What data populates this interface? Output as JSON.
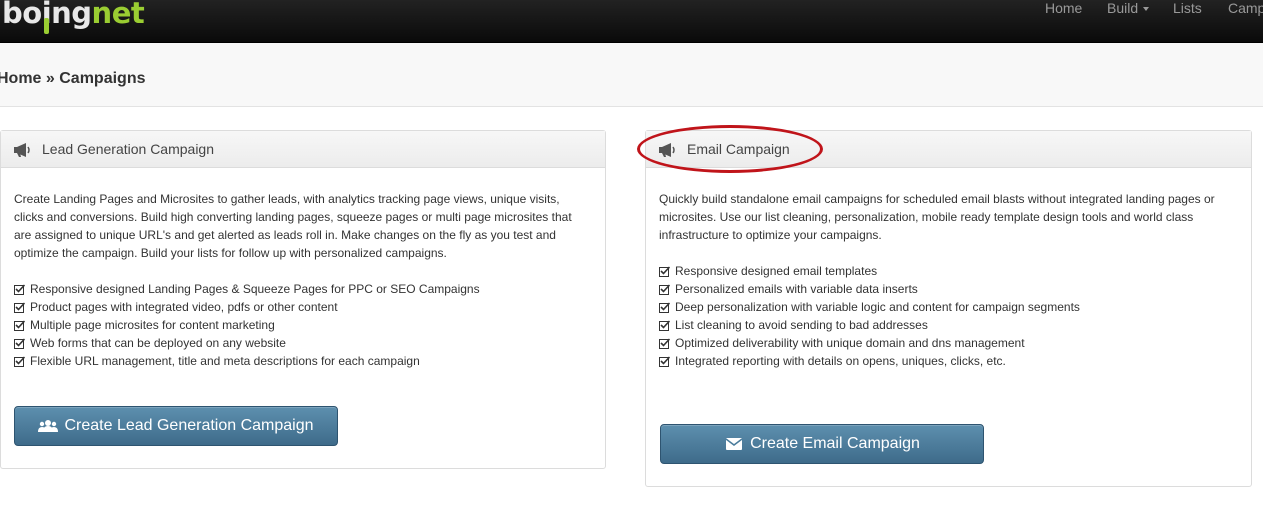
{
  "header": {
    "logo_prefix": "bo",
    "logo_mid": "i",
    "logo_suffix": "ng",
    "logo_net": "net",
    "nav": [
      {
        "label": "Home"
      },
      {
        "label": "Build"
      },
      {
        "label": "Lists"
      },
      {
        "label": "Camp"
      }
    ]
  },
  "breadcrumb": "Home » Campaigns",
  "panels": {
    "lead": {
      "title": "Lead Generation Campaign",
      "description": "Create Landing Pages and Microsites to gather leads, with analytics tracking page views, unique visits, clicks and conversions. Build high converting landing pages, squeeze pages or multi page microsites that are assigned to unique URL's and get alerted as leads roll in. Make changes on the fly as you test and optimize the campaign. Build your lists for follow up with personalized campaigns.",
      "features": [
        "Responsive designed Landing Pages & Squeeze Pages for PPC or SEO Campaigns",
        "Product pages with integrated video, pdfs or other content",
        "Multiple page microsites for content marketing",
        "Web forms that can be deployed on any website",
        "Flexible URL management, title and meta descriptions for each campaign"
      ],
      "button_label": "Create Lead Generation Campaign"
    },
    "email": {
      "title": "Email Campaign",
      "description": "Quickly build standalone email campaigns for scheduled email blasts without integrated landing pages or microsites. Use our list cleaning, personalization, mobile ready template design tools and world class infrastructure to optimize your campaigns.",
      "features": [
        "Responsive designed email templates",
        "Personalized emails with variable data inserts",
        "Deep personalization with variable logic and content for campaign segments",
        "List cleaning to avoid sending to bad addresses",
        "Optimized deliverability with unique domain and dns management",
        "Integrated reporting with details on opens, uniques, clicks, etc."
      ],
      "button_label": "Create Email Campaign"
    }
  },
  "icons": {
    "panel_icon": "bullhorn-icon",
    "feature_icon": "checkbox-checked-icon",
    "lead_button_icon": "users-icon",
    "email_button_icon": "envelope-icon"
  },
  "colors": {
    "navbar": "#111111",
    "brand_green": "#9acd32",
    "button": "#4a7c9c",
    "annotation_red": "#c0141a"
  }
}
